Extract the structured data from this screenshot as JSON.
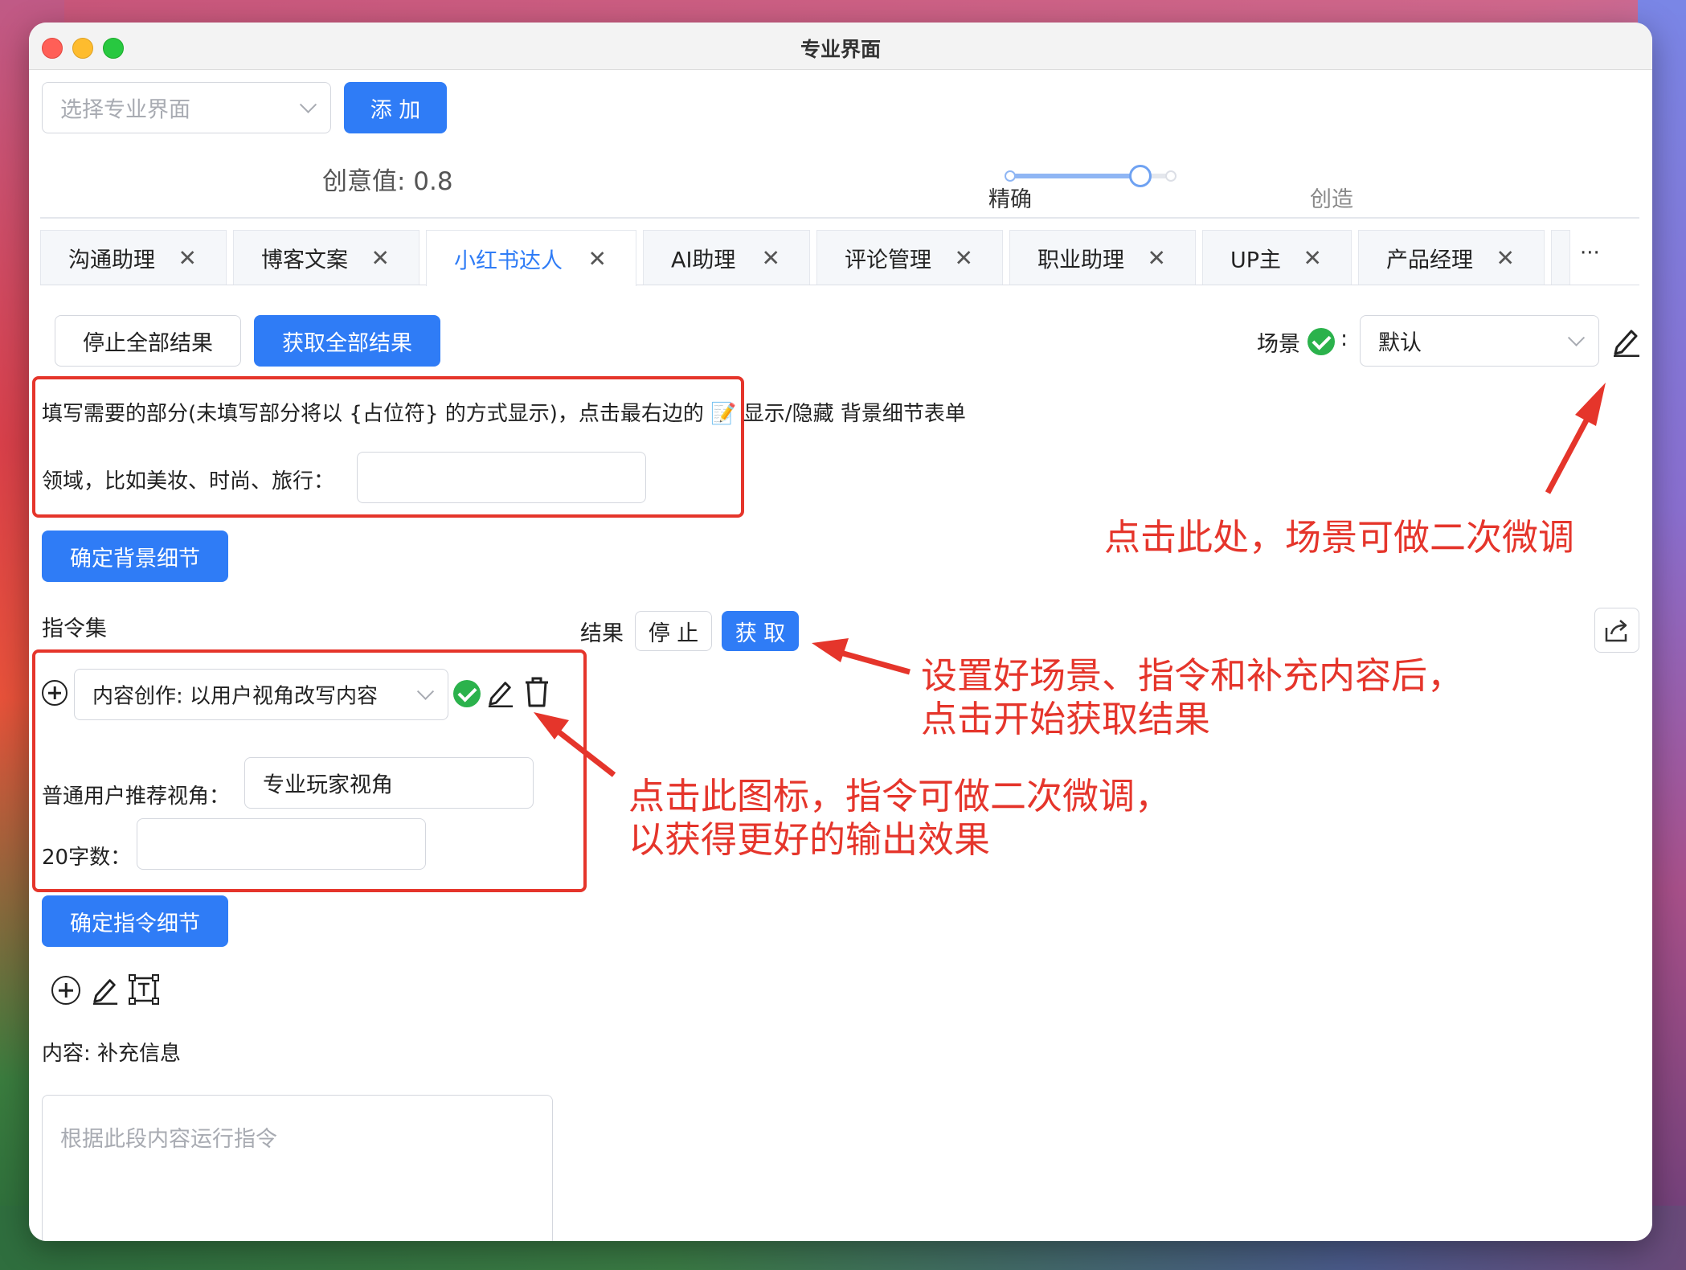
{
  "window": {
    "title": "专业界面"
  },
  "top": {
    "select_placeholder": "选择专业界面",
    "add_button": "添 加",
    "creativity_label": "创意值: 0.8",
    "creativity_value": 0.8,
    "slider_left": "精确",
    "slider_right": "创造"
  },
  "tabs": [
    {
      "label": "沟通助理"
    },
    {
      "label": "博客文案"
    },
    {
      "label": "小红书达人",
      "active": true
    },
    {
      "label": "AI助理"
    },
    {
      "label": "评论管理"
    },
    {
      "label": "职业助理"
    },
    {
      "label": "UP主"
    },
    {
      "label": "产品经理"
    }
  ],
  "tabs_more": "···",
  "tab_close": "✕",
  "actions": {
    "stop_all": "停止全部结果",
    "get_all": "获取全部结果",
    "scene_label": "场景",
    "scene_colon": ":",
    "scene_value": "默认"
  },
  "background_form": {
    "hint": "填写需要的部分(未填写部分将以 {占位符} 的方式显示)，点击最右边的 📝 显示/隐藏 背景细节表单",
    "domain_label": "领域，比如美妆、时尚、旅行：",
    "domain_value": "",
    "confirm_button": "确定背景细节"
  },
  "instructions": {
    "title": "指令集",
    "result_label": "结果",
    "stop_button": "停 止",
    "get_button": "获 取",
    "instruction_select": "内容创作: 以用户视角改写内容",
    "field1_label": "普通用户推荐视角：",
    "field1_value": "专业玩家视角",
    "field2_label": "20字数：",
    "field2_value": "",
    "confirm_button": "确定指令细节"
  },
  "content": {
    "label": "内容: 补充信息",
    "placeholder": "根据此段内容运行指令"
  },
  "annotations": {
    "scene_tip": "点击此处，场景可做二次微调",
    "get_tip_line1": "设置好场景、指令和补充内容后，",
    "get_tip_line2": "点击开始获取结果",
    "icon_tip_line1": "点击此图标，指令可做二次微调，",
    "icon_tip_line2": "以获得更好的输出效果"
  },
  "colors": {
    "primary": "#2f7cf6",
    "annotation": "#e5352b",
    "success": "#2bb24c"
  }
}
